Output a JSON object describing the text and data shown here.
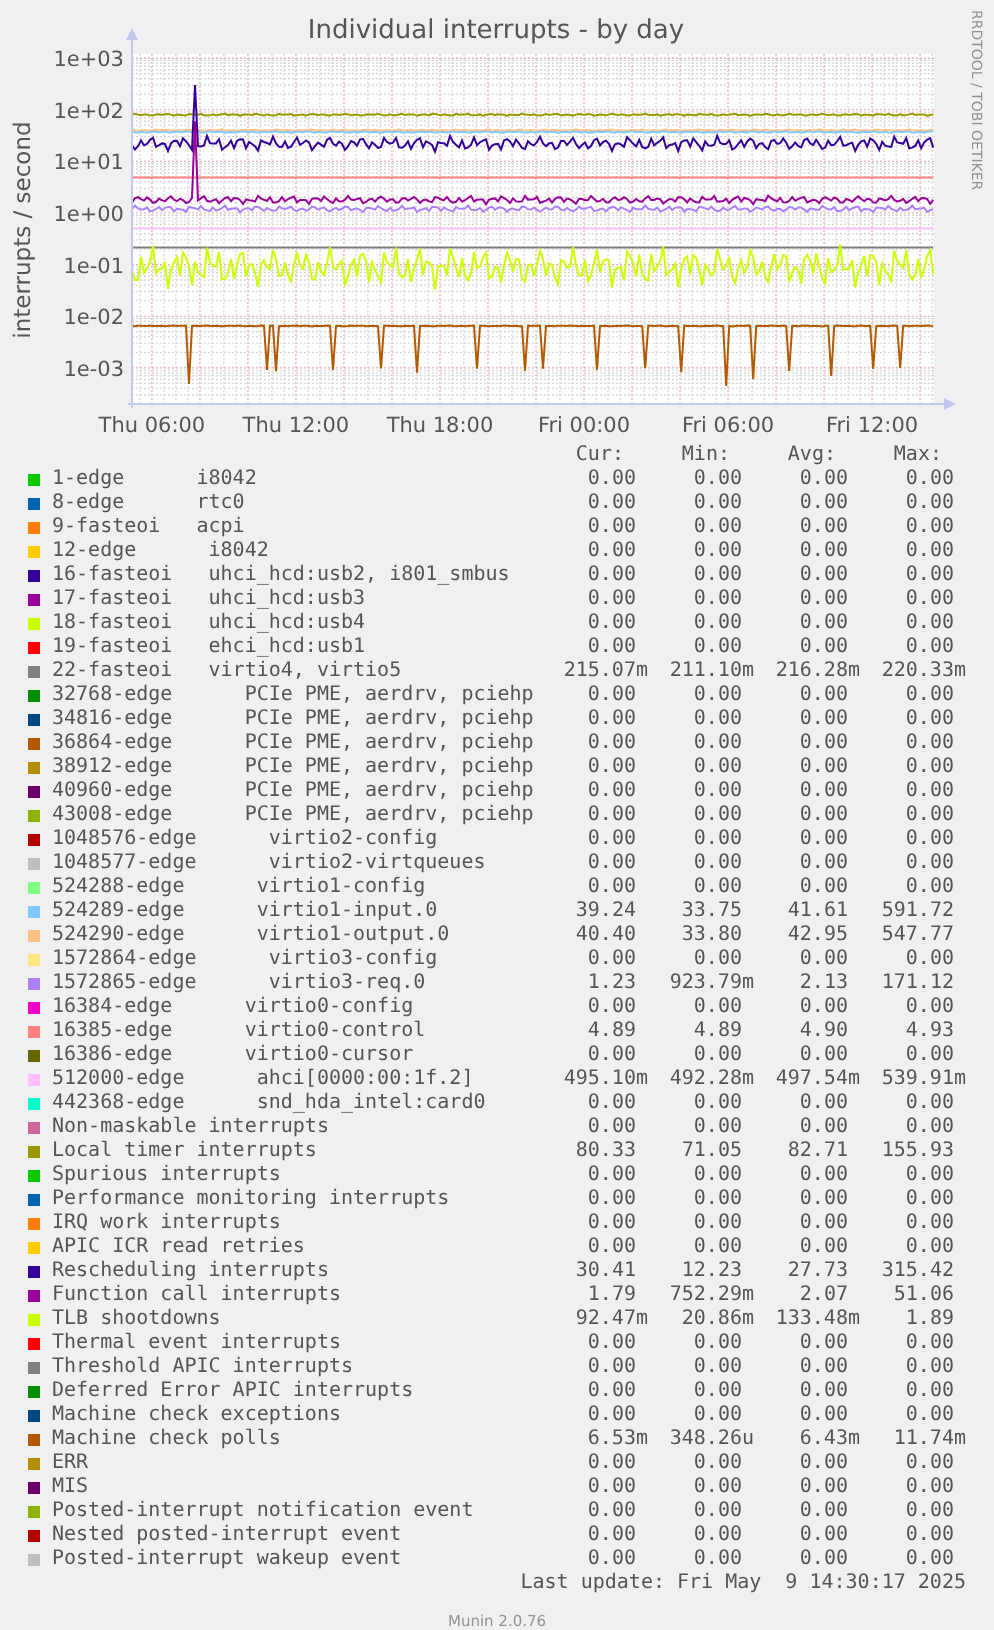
{
  "graph": {
    "title": "Individual interrupts - by day",
    "y_label": "interrupts / second",
    "y_axis_labels": [
      "1e+03",
      "1e+02",
      "1e+01",
      "1e+00",
      "1e-01",
      "1e-02",
      "1e-03"
    ],
    "x_axis_labels": [
      "Thu 06:00",
      "Thu 12:00",
      "Thu 18:00",
      "Fri 00:00",
      "Fri 06:00",
      "Fri 12:00"
    ],
    "credit": "RRDTOOL / TOBI OETIKER"
  },
  "legend": {
    "columns": [
      "Cur:",
      "Min:",
      "Avg:",
      "Max:"
    ],
    "rows": [
      {
        "name": "1-edge",
        "device": "i8042",
        "color": "#00cc00",
        "cur": "0.00",
        "min": "0.00",
        "avg": "0.00",
        "max": "0.00"
      },
      {
        "name": "8-edge",
        "device": "rtc0",
        "color": "#0066b3",
        "cur": "0.00",
        "min": "0.00",
        "avg": "0.00",
        "max": "0.00"
      },
      {
        "name": "9-fasteoi",
        "device": "acpi",
        "color": "#ff8000",
        "cur": "0.00",
        "min": "0.00",
        "avg": "0.00",
        "max": "0.00"
      },
      {
        "name": "12-edge",
        "device": "i8042",
        "color": "#ffcc00",
        "cur": "0.00",
        "min": "0.00",
        "avg": "0.00",
        "max": "0.00"
      },
      {
        "name": "16-fasteoi",
        "device": "uhci_hcd:usb2, i801_smbus",
        "color": "#330099",
        "cur": "0.00",
        "min": "0.00",
        "avg": "0.00",
        "max": "0.00"
      },
      {
        "name": "17-fasteoi",
        "device": "uhci_hcd:usb3",
        "color": "#990099",
        "cur": "0.00",
        "min": "0.00",
        "avg": "0.00",
        "max": "0.00"
      },
      {
        "name": "18-fasteoi",
        "device": "uhci_hcd:usb4",
        "color": "#ccff00",
        "cur": "0.00",
        "min": "0.00",
        "avg": "0.00",
        "max": "0.00"
      },
      {
        "name": "19-fasteoi",
        "device": "ehci_hcd:usb1",
        "color": "#ff0000",
        "cur": "0.00",
        "min": "0.00",
        "avg": "0.00",
        "max": "0.00"
      },
      {
        "name": "22-fasteoi",
        "device": "virtio4, virtio5",
        "color": "#808080",
        "cur": "215.07m",
        "min": "211.10m",
        "avg": "216.28m",
        "max": "220.33m"
      },
      {
        "name": "32768-edge",
        "device": "PCIe PME, aerdrv, pciehp",
        "color": "#008f00",
        "cur": "0.00",
        "min": "0.00",
        "avg": "0.00",
        "max": "0.00"
      },
      {
        "name": "34816-edge",
        "device": "PCIe PME, aerdrv, pciehp",
        "color": "#00487d",
        "cur": "0.00",
        "min": "0.00",
        "avg": "0.00",
        "max": "0.00"
      },
      {
        "name": "36864-edge",
        "device": "PCIe PME, aerdrv, pciehp",
        "color": "#b35a00",
        "cur": "0.00",
        "min": "0.00",
        "avg": "0.00",
        "max": "0.00"
      },
      {
        "name": "38912-edge",
        "device": "PCIe PME, aerdrv, pciehp",
        "color": "#b38f00",
        "cur": "0.00",
        "min": "0.00",
        "avg": "0.00",
        "max": "0.00"
      },
      {
        "name": "40960-edge",
        "device": "PCIe PME, aerdrv, pciehp",
        "color": "#6b006b",
        "cur": "0.00",
        "min": "0.00",
        "avg": "0.00",
        "max": "0.00"
      },
      {
        "name": "43008-edge",
        "device": "PCIe PME, aerdrv, pciehp",
        "color": "#8fb300",
        "cur": "0.00",
        "min": "0.00",
        "avg": "0.00",
        "max": "0.00"
      },
      {
        "name": "1048576-edge",
        "device": "virtio2-config",
        "color": "#b30000",
        "cur": "0.00",
        "min": "0.00",
        "avg": "0.00",
        "max": "0.00"
      },
      {
        "name": "1048577-edge",
        "device": "virtio2-virtqueues",
        "color": "#bebebe",
        "cur": "0.00",
        "min": "0.00",
        "avg": "0.00",
        "max": "0.00"
      },
      {
        "name": "524288-edge",
        "device": "virtio1-config",
        "color": "#80ff80",
        "cur": "0.00",
        "min": "0.00",
        "avg": "0.00",
        "max": "0.00"
      },
      {
        "name": "524289-edge",
        "device": "virtio1-input.0",
        "color": "#80c9ff",
        "cur": "39.24",
        "min": "33.75",
        "avg": "41.61",
        "max": "591.72"
      },
      {
        "name": "524290-edge",
        "device": "virtio1-output.0",
        "color": "#ffc080",
        "cur": "40.40",
        "min": "33.80",
        "avg": "42.95",
        "max": "547.77"
      },
      {
        "name": "1572864-edge",
        "device": "virtio3-config",
        "color": "#ffe680",
        "cur": "0.00",
        "min": "0.00",
        "avg": "0.00",
        "max": "0.00"
      },
      {
        "name": "1572865-edge",
        "device": "virtio3-req.0",
        "color": "#aa80ff",
        "cur": "1.23",
        "min": "923.79m",
        "avg": "2.13",
        "max": "171.12"
      },
      {
        "name": "16384-edge",
        "device": "virtio0-config",
        "color": "#ee00cc",
        "cur": "0.00",
        "min": "0.00",
        "avg": "0.00",
        "max": "0.00"
      },
      {
        "name": "16385-edge",
        "device": "virtio0-control",
        "color": "#ff8080",
        "cur": "4.89",
        "min": "4.89",
        "avg": "4.90",
        "max": "4.93"
      },
      {
        "name": "16386-edge",
        "device": "virtio0-cursor",
        "color": "#666600",
        "cur": "0.00",
        "min": "0.00",
        "avg": "0.00",
        "max": "0.00"
      },
      {
        "name": "512000-edge",
        "device": "ahci[0000:00:1f.2]",
        "color": "#ffbfff",
        "cur": "495.10m",
        "min": "492.28m",
        "avg": "497.54m",
        "max": "539.91m"
      },
      {
        "name": "442368-edge",
        "device": "snd_hda_intel:card0",
        "color": "#00ffcc",
        "cur": "0.00",
        "min": "0.00",
        "avg": "0.00",
        "max": "0.00"
      },
      {
        "name": "Non-maskable interrupts",
        "color": "#cc6699",
        "cur": "0.00",
        "min": "0.00",
        "avg": "0.00",
        "max": "0.00"
      },
      {
        "name": "Local timer interrupts",
        "color": "#999900",
        "cur": "80.33",
        "min": "71.05",
        "avg": "82.71",
        "max": "155.93"
      },
      {
        "name": "Spurious interrupts",
        "color": "#00cc00",
        "cur": "0.00",
        "min": "0.00",
        "avg": "0.00",
        "max": "0.00"
      },
      {
        "name": "Performance monitoring interrupts",
        "color": "#0066b3",
        "cur": "0.00",
        "min": "0.00",
        "avg": "0.00",
        "max": "0.00"
      },
      {
        "name": "IRQ work interrupts",
        "color": "#ff8000",
        "cur": "0.00",
        "min": "0.00",
        "avg": "0.00",
        "max": "0.00"
      },
      {
        "name": "APIC ICR read retries",
        "color": "#ffcc00",
        "cur": "0.00",
        "min": "0.00",
        "avg": "0.00",
        "max": "0.00"
      },
      {
        "name": "Rescheduling interrupts",
        "color": "#330099",
        "cur": "30.41",
        "min": "12.23",
        "avg": "27.73",
        "max": "315.42"
      },
      {
        "name": "Function call interrupts",
        "color": "#990099",
        "cur": "1.79",
        "min": "752.29m",
        "avg": "2.07",
        "max": "51.06"
      },
      {
        "name": "TLB shootdowns",
        "color": "#ccff00",
        "cur": "92.47m",
        "min": "20.86m",
        "avg": "133.48m",
        "max": "1.89"
      },
      {
        "name": "Thermal event interrupts",
        "color": "#ff0000",
        "cur": "0.00",
        "min": "0.00",
        "avg": "0.00",
        "max": "0.00"
      },
      {
        "name": "Threshold APIC interrupts",
        "color": "#808080",
        "cur": "0.00",
        "min": "0.00",
        "avg": "0.00",
        "max": "0.00"
      },
      {
        "name": "Deferred Error APIC interrupts",
        "color": "#008f00",
        "cur": "0.00",
        "min": "0.00",
        "avg": "0.00",
        "max": "0.00"
      },
      {
        "name": "Machine check exceptions",
        "color": "#00487d",
        "cur": "0.00",
        "min": "0.00",
        "avg": "0.00",
        "max": "0.00"
      },
      {
        "name": "Machine check polls",
        "color": "#b35a00",
        "cur": "6.53m",
        "min": "348.26u",
        "avg": "6.43m",
        "max": "11.74m"
      },
      {
        "name": "ERR",
        "color": "#b38f00",
        "cur": "0.00",
        "min": "0.00",
        "avg": "0.00",
        "max": "0.00"
      },
      {
        "name": "MIS",
        "color": "#6b006b",
        "cur": "0.00",
        "min": "0.00",
        "avg": "0.00",
        "max": "0.00"
      },
      {
        "name": "Posted-interrupt notification event",
        "color": "#8fb300",
        "cur": "0.00",
        "min": "0.00",
        "avg": "0.00",
        "max": "0.00"
      },
      {
        "name": "Nested posted-interrupt event",
        "color": "#b30000",
        "cur": "0.00",
        "min": "0.00",
        "avg": "0.00",
        "max": "0.00"
      },
      {
        "name": "Posted-interrupt wakeup event",
        "color": "#bebebe",
        "cur": "0.00",
        "min": "0.00",
        "avg": "0.00",
        "max": "0.00"
      }
    ]
  },
  "last_update": "Last update: Fri May  9 14:30:17 2025",
  "version": "Munin 2.0.76"
}
